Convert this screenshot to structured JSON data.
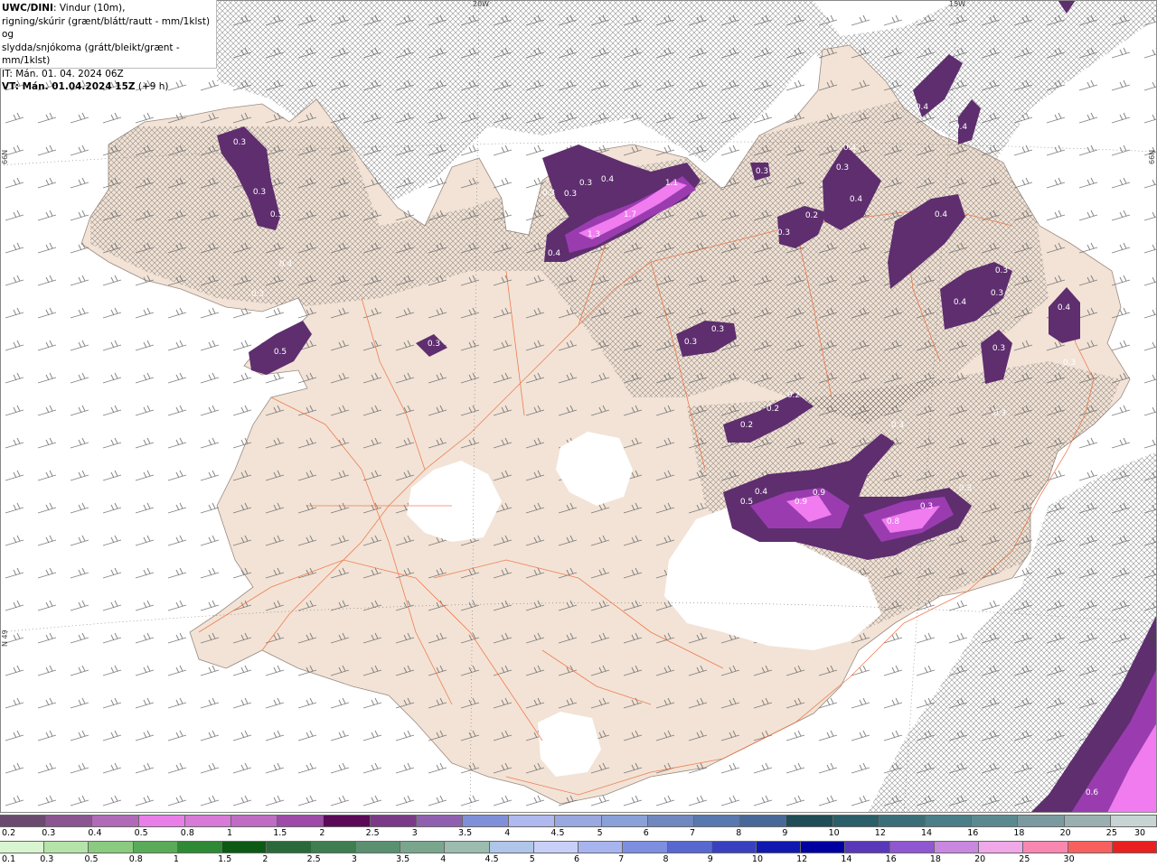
{
  "title": {
    "model": "UWC/DINI",
    "line1_rest": ": Vindur (10m),",
    "line2": "rigning/skúrir (grænt/blátt/rautt - mm/1klst) og",
    "line3": "slydda/snjókoma (grátt/bleikt/grænt - mm/1klst)",
    "line4": "IT: Mán. 01. 04. 2024 06Z",
    "line5_bold": "VT: Mán. 01.04.2024 15Z",
    "line5_rest": " (+9 h)"
  },
  "grid_labels": {
    "lon_20w": "20W",
    "lon_15w": "15W",
    "lat_66n": "66N",
    "lat_64n": "N 49",
    "lat_66n_right": "66N",
    "lat_64n_right": "64N"
  },
  "colors": {
    "land": "#f2e3d6",
    "sea": "#ffffff",
    "roads": "#ef6c3a",
    "hatch": "#333333",
    "precip_dark": "#5e2e6f",
    "precip_mid": "#9a3cb0",
    "precip_light": "#f07cf0"
  },
  "values": [
    "0.3",
    "0.3",
    "0.3",
    "0.4",
    "0.3",
    "0.5",
    "0.3",
    "0.3",
    "0.3",
    "0.4",
    "0.3",
    "1.1",
    "1.3",
    "1.7",
    "0.4",
    "0.3",
    "0.3",
    "0.3",
    "0.2",
    "0.3",
    "0.3",
    "0.4",
    "0.4",
    "0.4",
    "0.4",
    "0.4",
    "0.3",
    "0.4",
    "0.3",
    "0.3",
    "0.4",
    "0.3",
    "0.2",
    "0.2",
    "0.2",
    "0.3",
    "0.5",
    "0.4",
    "0.9",
    "0.8",
    "0.9",
    "0.3",
    "0.3",
    "0.3",
    "0.6"
  ],
  "legend_snow": {
    "labels": [
      "0.2",
      "0.3",
      "0.4",
      "0.5",
      "0.8",
      "1",
      "1.5",
      "2",
      "2.5",
      "3",
      "3.5",
      "4",
      "4.5",
      "5",
      "6",
      "7",
      "8",
      "9",
      "10",
      "12",
      "14",
      "16",
      "18",
      "20",
      "25",
      "30"
    ],
    "colors": [
      "#6a4a6e",
      "#8a5590",
      "#b06ab8",
      "#e97ee9",
      "#d77ad8",
      "#bf6cc5",
      "#9e4aa8",
      "#5b0a58",
      "#7a3a88",
      "#9060b0",
      "#8090d8",
      "#b0b8f0",
      "#9aa8e0",
      "#8aa0d8",
      "#7088c0",
      "#5a78b0",
      "#48689a",
      "#1e4d58",
      "#2a5e68",
      "#3a6e78",
      "#4a7e88",
      "#5a8a90",
      "#7a9aa0",
      "#9ab0b0",
      "#c8d4d4"
    ]
  },
  "legend_rain": {
    "labels": [
      "0.1",
      "0.3",
      "0.5",
      "0.8",
      "1",
      "1.5",
      "2",
      "2.5",
      "3",
      "3.5",
      "4",
      "4.5",
      "5",
      "6",
      "7",
      "8",
      "9",
      "10",
      "12",
      "14",
      "16",
      "18",
      "20",
      "25",
      "30"
    ],
    "colors": [
      "#d8f4d0",
      "#b4e4a8",
      "#8acb80",
      "#5aab58",
      "#2e8a34",
      "#0c5a14",
      "#2a6a3a",
      "#3e7e50",
      "#5a9070",
      "#7aa68e",
      "#9cbcb0",
      "#b0c6e8",
      "#c8d0f8",
      "#a8b4f0",
      "#7e8ee0",
      "#5868d0",
      "#3840c0",
      "#1018b0",
      "#0000a0",
      "#5838b8",
      "#9058d0",
      "#c888e0",
      "#f0a8e8",
      "#f888b0",
      "#f86060",
      "#e82020"
    ]
  }
}
